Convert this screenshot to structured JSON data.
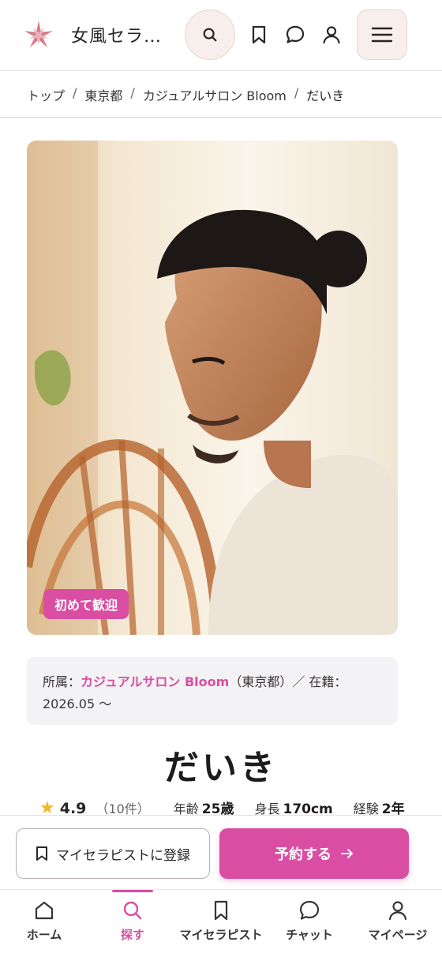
{
  "header": {
    "site_title": "女風セラ…",
    "icons": [
      "search-icon",
      "bookmark-icon",
      "chat-icon",
      "user-icon",
      "menu-icon"
    ]
  },
  "breadcrumb": {
    "items": [
      "トップ",
      "東京都",
      "カジュアルサロン Bloom"
    ],
    "current": "だいき",
    "separator": "/"
  },
  "profile": {
    "badge": "初めて歓迎",
    "affiliation_prefix": "所属：",
    "salon_name": "カジュアルサロン Bloom",
    "affiliation_suffix": "（東京都）／ 在籍：",
    "tenure": "2026.05 〜",
    "name": "だいき",
    "rating": "4.9",
    "review_count": "（10件）",
    "stats": [
      {
        "label": "年齢",
        "value": "25歳"
      },
      {
        "label": "身長",
        "value": "170cm"
      },
      {
        "label": "経験",
        "value": "2年"
      }
    ]
  },
  "actions": {
    "register_label": "マイセラピストに登録",
    "book_label": "予約する"
  },
  "bottom_nav": [
    {
      "label": "ホーム",
      "icon": "home-icon",
      "active": false
    },
    {
      "label": "探す",
      "icon": "search-icon",
      "active": true
    },
    {
      "label": "マイセラピスト",
      "icon": "bookmark-icon",
      "active": false
    },
    {
      "label": "チャット",
      "icon": "chat-icon",
      "active": false
    },
    {
      "label": "マイページ",
      "icon": "user-icon",
      "active": false
    }
  ],
  "colors": {
    "accent": "#d94ea2",
    "star": "#f2b82c",
    "header_button_bg": "#f8efec"
  }
}
